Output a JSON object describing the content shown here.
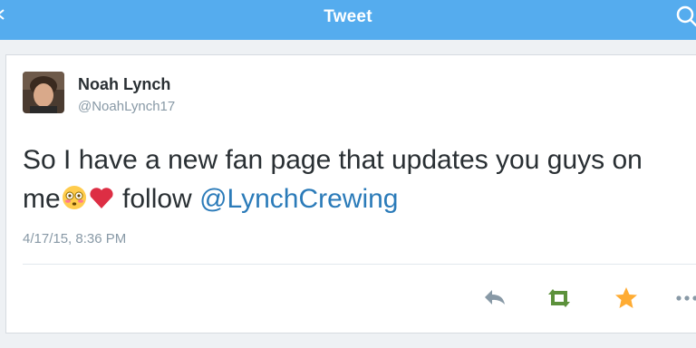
{
  "nav": {
    "title": "Tweet",
    "icons": {
      "search": "search-icon",
      "back": "chevron-left-icon"
    },
    "color": "#55acee"
  },
  "tweet": {
    "author": {
      "name": "Noah Lynch",
      "handle": "@NoahLynch17",
      "avatar_icon": "profile-photo"
    },
    "text_line1": "So I have a new fan page that updates you guys on",
    "text_line2_prefix": "me",
    "text_line2_mid": " follow ",
    "mention": "@LynchCrewing",
    "emojis": [
      "flushed-face-emoji",
      "red-heart-emoji"
    ],
    "timestamp": "4/17/15, 8:36 PM",
    "mention_color": "#2b7bb9"
  },
  "actions": {
    "reply_icon": "reply-icon",
    "retweet_icon": "retweet-icon",
    "favorite_icon": "star-icon",
    "more_icon": "more-icon",
    "favorite_color": "#ffac33",
    "retweet_color": "#5c913b"
  }
}
